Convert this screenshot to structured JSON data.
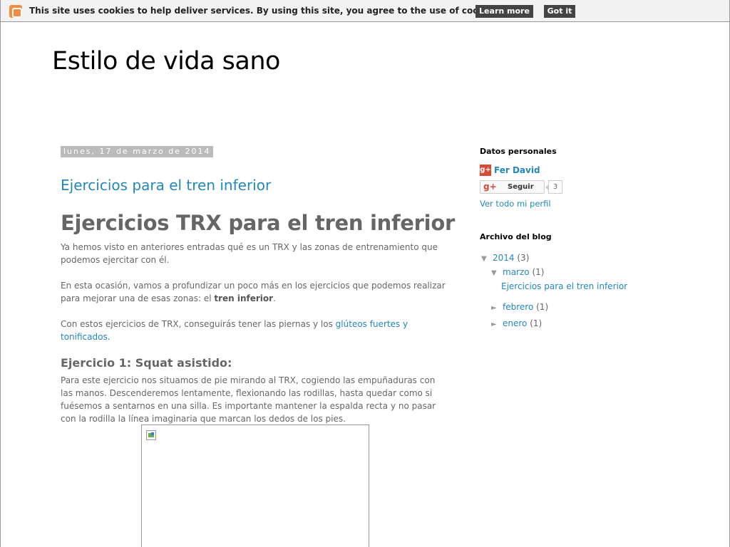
{
  "cookie_bar": {
    "message": "This site uses cookies to help deliver services. By using this site, you agree to the use of cookies.",
    "learn_more": "Learn more",
    "got_it": "Got it"
  },
  "header": {
    "blog_title": "Estilo de vida sano"
  },
  "post": {
    "date": "lunes, 17 de marzo de 2014",
    "title": "Ejercicios para el tren inferior",
    "heading": "Ejercicios TRX para el tren inferior",
    "p1": "Ya hemos visto en anteriores entradas qué es un TRX y las zonas de entrenamiento que podemos ejercitar con él.",
    "p2_before": "En esta ocasión, vamos a profundizar un poco más en los ejercicios que podemos realizar para mejorar una de esas zonas: el ",
    "p2_bold": "tren inferior",
    "p2_after": ".",
    "p3_before": "Con estos ejercicios de TRX, conseguirás tener las piernas y los ",
    "p3_link": "glúteos fuertes y tonificados",
    "p3_after": ".",
    "exercise1_heading": "Ejercicio 1: Squat asistido:",
    "exercise1_text": "Para este ejercicio nos situamos de pie mirando al TRX, cogiendo las empuñaduras con las manos. Descenderemos lentamente, flexionando las rodillas, hasta quedar como si fuésemos a sentarnos en una silla. Es importante mantener la espalda recta y no pasar con la rodilla la línea imaginaria que marcan los dedos de los pies.",
    "image_icon": "broken-image-icon"
  },
  "sidebar": {
    "profile": {
      "heading": "Datos personales",
      "name": "Fer David",
      "follow_label": "Seguir",
      "follow_count": "3",
      "view_profile": "Ver todo mi perfil"
    },
    "archive": {
      "heading": "Archivo del blog",
      "items": [
        {
          "toggle": "▼",
          "label": "2014",
          "count": "(3)"
        },
        {
          "toggle": "▼",
          "label": "marzo",
          "count": "(1)"
        },
        {
          "toggle": "",
          "label": "Ejercicios para el tren inferior",
          "count": ""
        },
        {
          "toggle": "►",
          "label": "febrero",
          "count": "(1)"
        },
        {
          "toggle": "►",
          "label": "enero",
          "count": "(1)"
        }
      ]
    }
  },
  "colors": {
    "link": "#2288bb",
    "text": "#666666",
    "date_bg": "#bbbbbb",
    "cookie_button": "#444444",
    "gplus_red": "#d84a38"
  }
}
